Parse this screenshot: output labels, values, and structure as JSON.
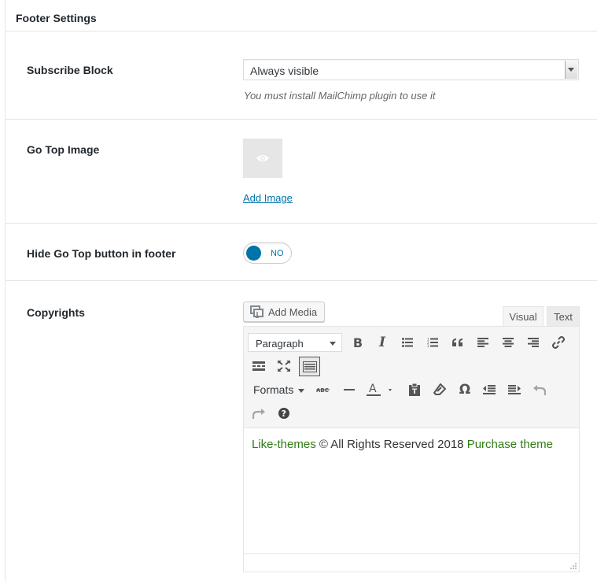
{
  "panel": {
    "title": "Footer Settings"
  },
  "subscribe": {
    "label": "Subscribe Block",
    "selected": "Always visible",
    "description": "You must install MailChimp plugin to use it"
  },
  "gotop_image": {
    "label": "Go Top Image",
    "add_image": "Add Image"
  },
  "hide_gotop": {
    "label": "Hide Go Top button in footer",
    "toggle_text": "NO"
  },
  "copyrights": {
    "label": "Copyrights",
    "add_media": "Add Media",
    "tabs": {
      "visual": "Visual",
      "text": "Text"
    },
    "toolbar": {
      "paragraph": "Paragraph",
      "formats": "Formats",
      "row1_icons": [
        "bold-icon",
        "italic-icon",
        "bullet-list-icon",
        "numbered-list-icon",
        "blockquote-icon",
        "align-left-icon",
        "align-center-icon",
        "align-right-icon",
        "link-icon"
      ],
      "row2_icons": [
        "read-more-icon",
        "fullscreen-icon",
        "toolbar-toggle-icon"
      ],
      "row3_icons": [
        "strikethrough-icon",
        "horizontal-line-icon",
        "text-color-icon",
        "paste-text-icon",
        "clear-formatting-icon",
        "special-character-icon",
        "outdent-icon",
        "indent-icon",
        "undo-icon"
      ],
      "row4_icons": [
        "redo-icon",
        "help-icon"
      ]
    },
    "content": {
      "link1": "Like-themes",
      "middle": " © All Rights Reserved 2018 ",
      "link2": "Purchase theme"
    }
  },
  "colors": {
    "accent": "#0073aa",
    "link_green": "#2e7d14",
    "border": "#e5e5e5"
  }
}
